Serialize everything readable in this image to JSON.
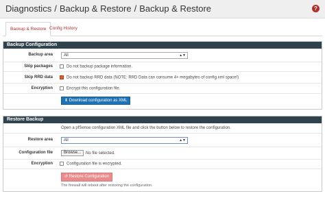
{
  "breadcrumb": {
    "items": [
      "Diagnostics",
      "Backup & Restore",
      "Backup & Restore"
    ],
    "separator": "/"
  },
  "help_icon": "?",
  "tabs": [
    {
      "label": "Backup & Restore",
      "active": true
    },
    {
      "label": "Config History",
      "active": false
    }
  ],
  "backup": {
    "title": "Backup Configuration",
    "area_label": "Backup area",
    "area_value": "All",
    "skip_packages_label": "Skip packages",
    "skip_packages_text": "Do not backup package information.",
    "skip_packages_checked": false,
    "skip_rrd_label": "Skip RRD data",
    "skip_rrd_text": "Do not backup RRD data (NOTE: RRD Data can consume 4+ megabytes of config.xml space!)",
    "skip_rrd_checked": true,
    "encryption_label": "Encryption",
    "encryption_text": "Encrypt this configuration file.",
    "encryption_checked": false,
    "download_button": "Download configuration as XML"
  },
  "restore": {
    "title": "Restore Backup",
    "description": "Open a pfSense configuration XML file and click the button below to restore the configuration.",
    "area_label": "Restore area",
    "area_value": "All",
    "file_label": "Configuration file",
    "browse_button": "Browse...",
    "file_status": "No file selected.",
    "encryption_label": "Encryption",
    "encryption_text": "Configuration file is encrypted.",
    "encryption_checked": false,
    "restore_button": "Restore Configuration",
    "reboot_note": "The firewall will reboot after restoring the configuration."
  },
  "colors": {
    "panel_header": "#30424e",
    "accent_red": "#b0302c",
    "primary_blue": "#1e72b5",
    "warning_orange": "#d9602a",
    "restore_disabled": "#e88c8c"
  }
}
